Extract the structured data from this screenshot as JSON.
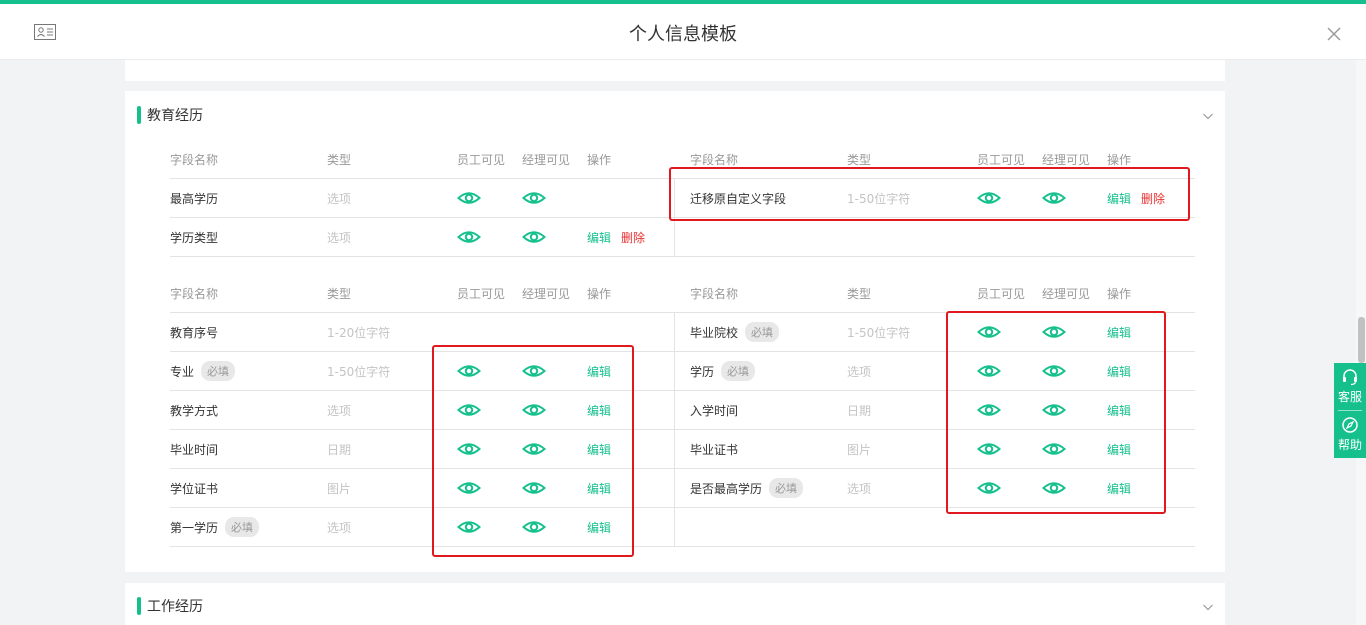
{
  "header": {
    "title": "个人信息模板",
    "card_icon": "id-card-icon",
    "close_icon": "close-icon"
  },
  "education": {
    "title": "教育经历",
    "columns": {
      "name": "字段名称",
      "type": "类型",
      "employee_visible": "员工可见",
      "manager_visible": "经理可见",
      "operation": "操作"
    },
    "group1": {
      "left": [
        {
          "name": "最高学历",
          "type": "选项",
          "required": "",
          "emp": true,
          "mgr": true,
          "edit": "",
          "del": ""
        },
        {
          "name": "学历类型",
          "type": "选项",
          "required": "",
          "emp": true,
          "mgr": true,
          "edit": "编辑",
          "del": "删除"
        }
      ],
      "right": [
        {
          "name": "迁移原自定义字段",
          "type": "1-50位字符",
          "required": "",
          "emp": true,
          "mgr": true,
          "edit": "编辑",
          "del": "删除"
        }
      ]
    },
    "group2": {
      "left": [
        {
          "name": "教育序号",
          "type": "1-20位字符",
          "required": "",
          "emp": false,
          "mgr": false,
          "edit": ""
        },
        {
          "name": "专业",
          "type": "1-50位字符",
          "required": "必填",
          "emp": true,
          "mgr": true,
          "edit": "编辑"
        },
        {
          "name": "教学方式",
          "type": "选项",
          "required": "",
          "emp": true,
          "mgr": true,
          "edit": "编辑"
        },
        {
          "name": "毕业时间",
          "type": "日期",
          "required": "",
          "emp": true,
          "mgr": true,
          "edit": "编辑"
        },
        {
          "name": "学位证书",
          "type": "图片",
          "required": "",
          "emp": true,
          "mgr": true,
          "edit": "编辑"
        },
        {
          "name": "第一学历",
          "type": "选项",
          "required": "必填",
          "emp": true,
          "mgr": true,
          "edit": "编辑"
        }
      ],
      "right": [
        {
          "name": "毕业院校",
          "type": "1-50位字符",
          "required": "必填",
          "emp": true,
          "mgr": true,
          "edit": "编辑"
        },
        {
          "name": "学历",
          "type": "选项",
          "required": "必填",
          "emp": true,
          "mgr": true,
          "edit": "编辑"
        },
        {
          "name": "入学时间",
          "type": "日期",
          "required": "",
          "emp": true,
          "mgr": true,
          "edit": "编辑"
        },
        {
          "name": "毕业证书",
          "type": "图片",
          "required": "",
          "emp": true,
          "mgr": true,
          "edit": "编辑"
        },
        {
          "name": "是否最高学历",
          "type": "选项",
          "required": "必填",
          "emp": true,
          "mgr": true,
          "edit": "编辑"
        }
      ]
    }
  },
  "work": {
    "title": "工作经历"
  },
  "side": {
    "service": "客服",
    "help": "帮助"
  },
  "colors": {
    "accent": "#16c08d",
    "danger": "#e83030",
    "highlight": "#e0191f"
  }
}
